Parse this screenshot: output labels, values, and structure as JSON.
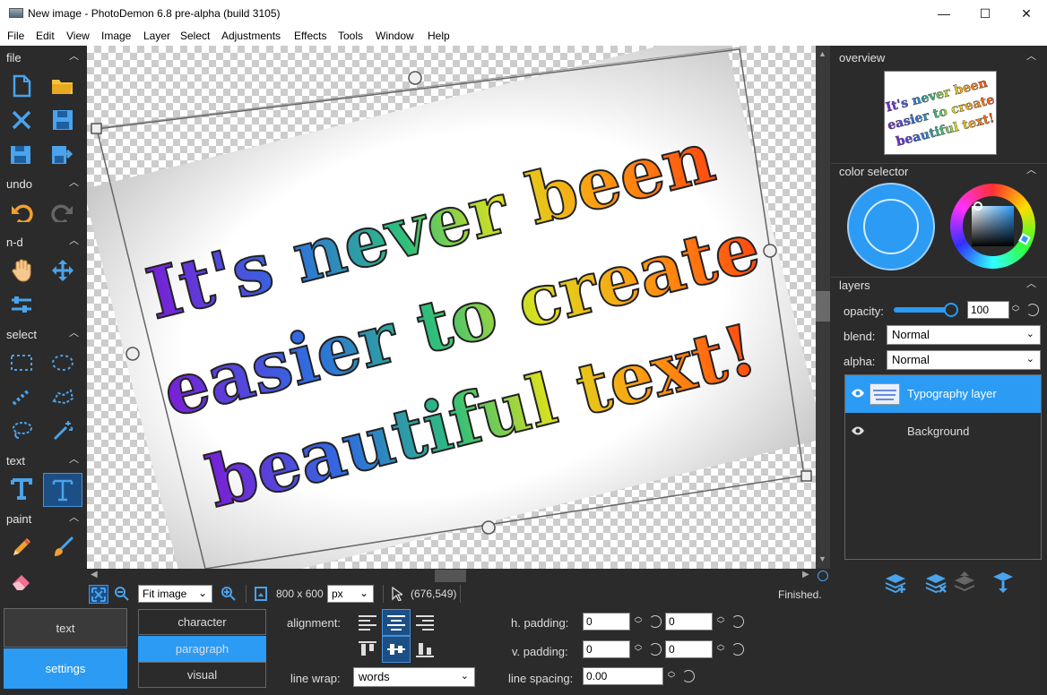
{
  "window": {
    "title": "New image  -  PhotoDemon 6.8 pre-alpha (build 3105)",
    "minimize": "—",
    "maximize": "☐",
    "close": "✕"
  },
  "menu": [
    "File",
    "Edit",
    "View",
    "Image",
    "Layer",
    "Select",
    "Adjustments",
    "Effects",
    "Tools",
    "Window",
    "Help"
  ],
  "toolbox": {
    "sections": {
      "file": "file",
      "undo": "undo",
      "nd": "n-d",
      "select": "select",
      "text": "text",
      "paint": "paint"
    }
  },
  "canvas": {
    "lines": [
      "It's never been",
      "easier to create",
      "beautiful text!"
    ]
  },
  "status": {
    "zoom": "Fit image",
    "size": "800 x 600",
    "unit": "px",
    "coords": "(676,549)",
    "message": "Finished."
  },
  "options": {
    "tabs": {
      "text": "text",
      "settings": "settings"
    },
    "subtabs": {
      "character": "character",
      "paragraph": "paragraph",
      "visual": "visual"
    },
    "alignment_label": "alignment:",
    "linewrap_label": "line wrap:",
    "linewrap_value": "words",
    "hpadding_label": "h. padding:",
    "hpadding_1": "0",
    "hpadding_2": "0",
    "vpadding_label": "v. padding:",
    "vpadding_1": "0",
    "vpadding_2": "0",
    "linespacing_label": "line spacing:",
    "linespacing_value": "0.00"
  },
  "panels": {
    "overview": "overview",
    "color_selector": "color selector",
    "layers": "layers",
    "opacity_label": "opacity:",
    "opacity_value": "100",
    "opacity_level": 1.0,
    "blend_label": "blend:",
    "blend_value": "Normal",
    "alpha_label": "alpha:",
    "alpha_value": "Normal",
    "layer_items": [
      "Typography layer",
      "Background"
    ]
  },
  "colors": {
    "primary": "#2b9bf4",
    "selection": "#2b9bf4",
    "accent_blue": "#4aa3ec"
  }
}
